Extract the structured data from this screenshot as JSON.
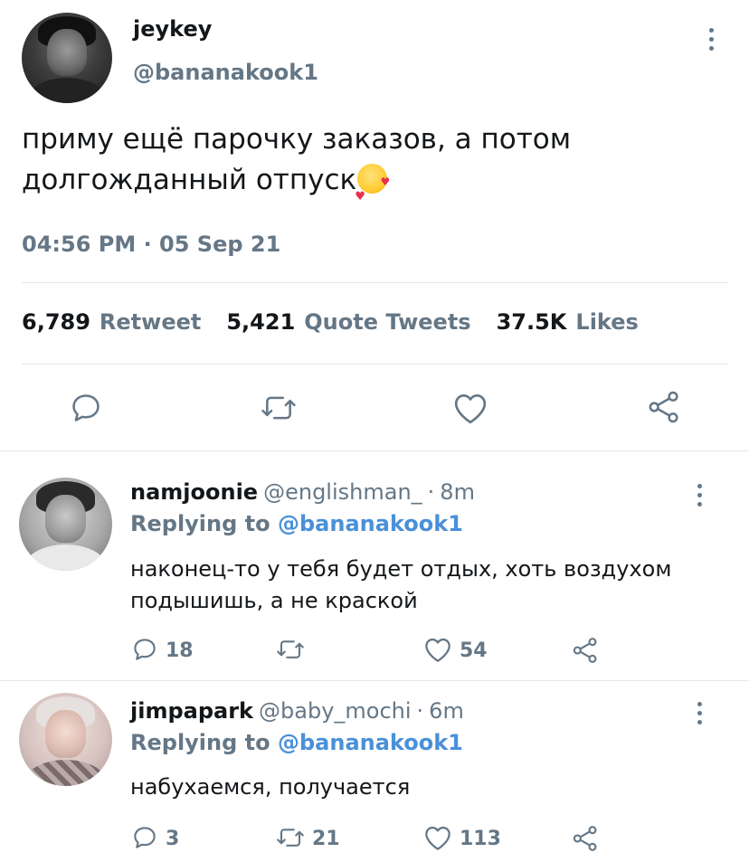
{
  "tweet": {
    "display_name": "jeykey",
    "handle": "@bananakook1",
    "text": "приму ещё парочку заказов, а потом долгожданный отпуск",
    "emoji": "smiling-face-with-hearts",
    "timestamp": "04:56 PM · 05 Sep 21",
    "stats": {
      "retweets_count": "6,789",
      "retweets_label": "Retweet",
      "quotes_count": "5,421",
      "quotes_label": "Quote Tweets",
      "likes_count": "37.5K",
      "likes_label": "Likes"
    },
    "actions": [
      "reply-icon",
      "retweet-icon",
      "like-icon",
      "share-icon"
    ]
  },
  "replies": [
    {
      "display_name": "namjoonie",
      "handle": "@englishman_",
      "separator": "·",
      "time": "8m",
      "replying_label": "Replying to",
      "replying_to": "@bananakook1",
      "text": "наконец-то у тебя будет отдых, хоть воздухом подышишь, а не краской",
      "reply_count": "18",
      "retweet_count": "",
      "like_count": "54"
    },
    {
      "display_name": "jimpapark",
      "handle": "@baby_mochi",
      "separator": "·",
      "time": "6m",
      "replying_label": "Replying to",
      "replying_to": "@bananakook1",
      "text": "набухаемся, получается",
      "reply_count": "3",
      "retweet_count": "21",
      "like_count": "113"
    }
  ],
  "colors": {
    "text_primary": "#14171a",
    "text_secondary": "#657786",
    "link": "#4a90d9",
    "divider": "#e1e8ed"
  }
}
